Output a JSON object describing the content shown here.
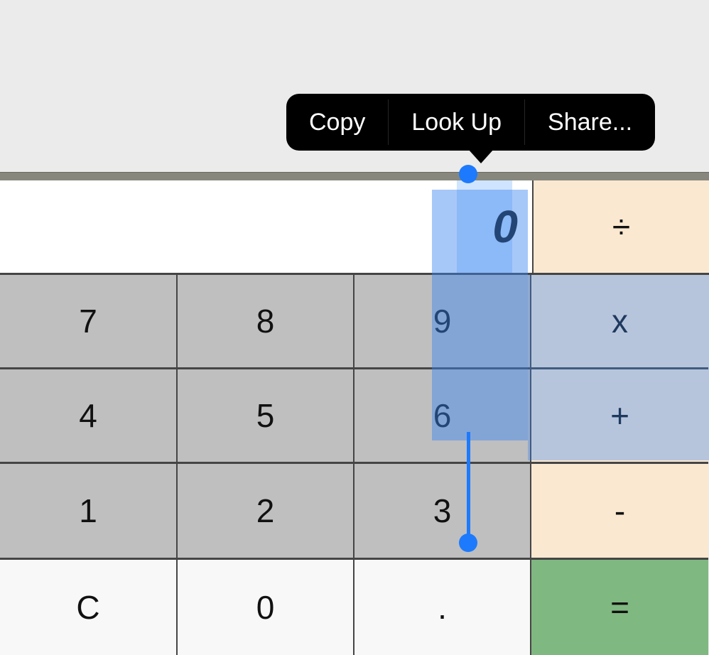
{
  "context_menu": {
    "items": [
      "Copy",
      "Look Up",
      "Share..."
    ]
  },
  "display": {
    "value": "0",
    "selected": true
  },
  "keys": {
    "divide": "÷",
    "multiply": "x",
    "plus": "+",
    "minus": "-",
    "equals": "=",
    "clear": "C",
    "decimal": ".",
    "k0": "0",
    "k1": "1",
    "k2": "2",
    "k3": "3",
    "k4": "4",
    "k5": "5",
    "k6": "6",
    "k7": "7",
    "k8": "8",
    "k9": "9"
  },
  "colors": {
    "number_key": "#bfbfbf",
    "operator_key": "#fae8d1",
    "equals_key": "#80b881",
    "light_key": "#f8f8f8",
    "selection": "#1d7afc",
    "selection_fill": "rgba(58,133,241,0.45)"
  }
}
